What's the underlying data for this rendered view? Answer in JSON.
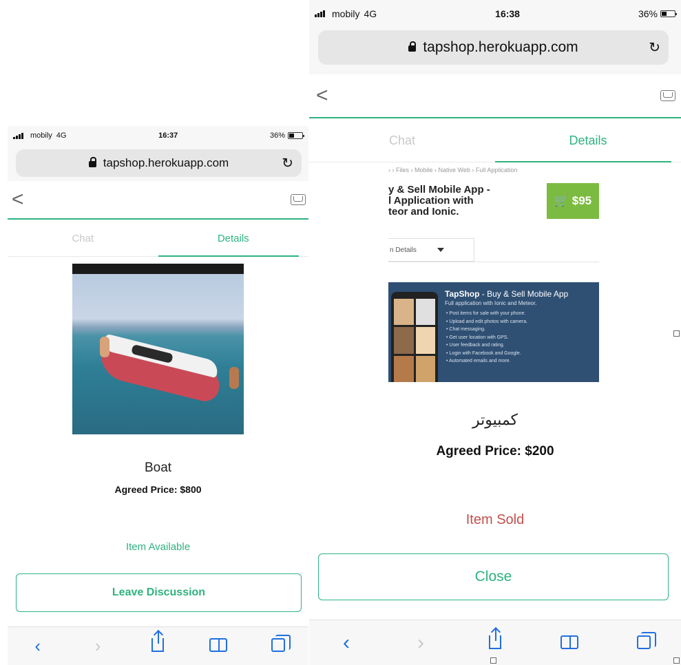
{
  "left_screen": {
    "status": {
      "carrier": "mobily",
      "network": "4G",
      "time": "16:37",
      "battery": "36%"
    },
    "url": "tapshop.herokuapp.com",
    "tabs": {
      "chat": "Chat",
      "details": "Details"
    },
    "item": {
      "title": "Boat",
      "price": "Agreed Price: $800",
      "status": "Item Available"
    },
    "action_button": "Leave Discussion",
    "toolbar": {
      "back": "‹",
      "forward": "›"
    }
  },
  "right_screen": {
    "status": {
      "carrier": "mobily",
      "network": "4G",
      "time": "16:38",
      "battery": "36%"
    },
    "url": "tapshop.herokuapp.com",
    "tabs": {
      "chat": "Chat",
      "details": "Details"
    },
    "webpage": {
      "breadcrumb": "› › Files › Mobile › Native Web › Full Application",
      "title_line1": "y & Sell Mobile App -",
      "title_line2": "l Application with",
      "title_line3": "teor and Ionic.",
      "buy_label": "🛒 $95",
      "dropdown_label": "n Details",
      "banner_brand": "TapShop",
      "banner_headline": " - Buy & Sell Mobile App",
      "banner_sub": "Full application with Ionic and Meteor.",
      "features": [
        "Post items for sale with your phone.",
        "Upload and edit photos with camera.",
        "Chat messaging.",
        "Get user location with GPS.",
        "User feedback and rating.",
        "Login with Facebook and Google.",
        "Automated emails and more."
      ]
    },
    "item": {
      "title": "كمبيوتر",
      "price": "Agreed Price: $200",
      "status": "Item Sold"
    },
    "action_button": "Close",
    "toolbar": {
      "back": "‹",
      "forward": "›"
    }
  },
  "colors": {
    "accent_green": "#2db37f",
    "sold_red": "#c0504d",
    "ios_blue": "#1f6fe0"
  }
}
